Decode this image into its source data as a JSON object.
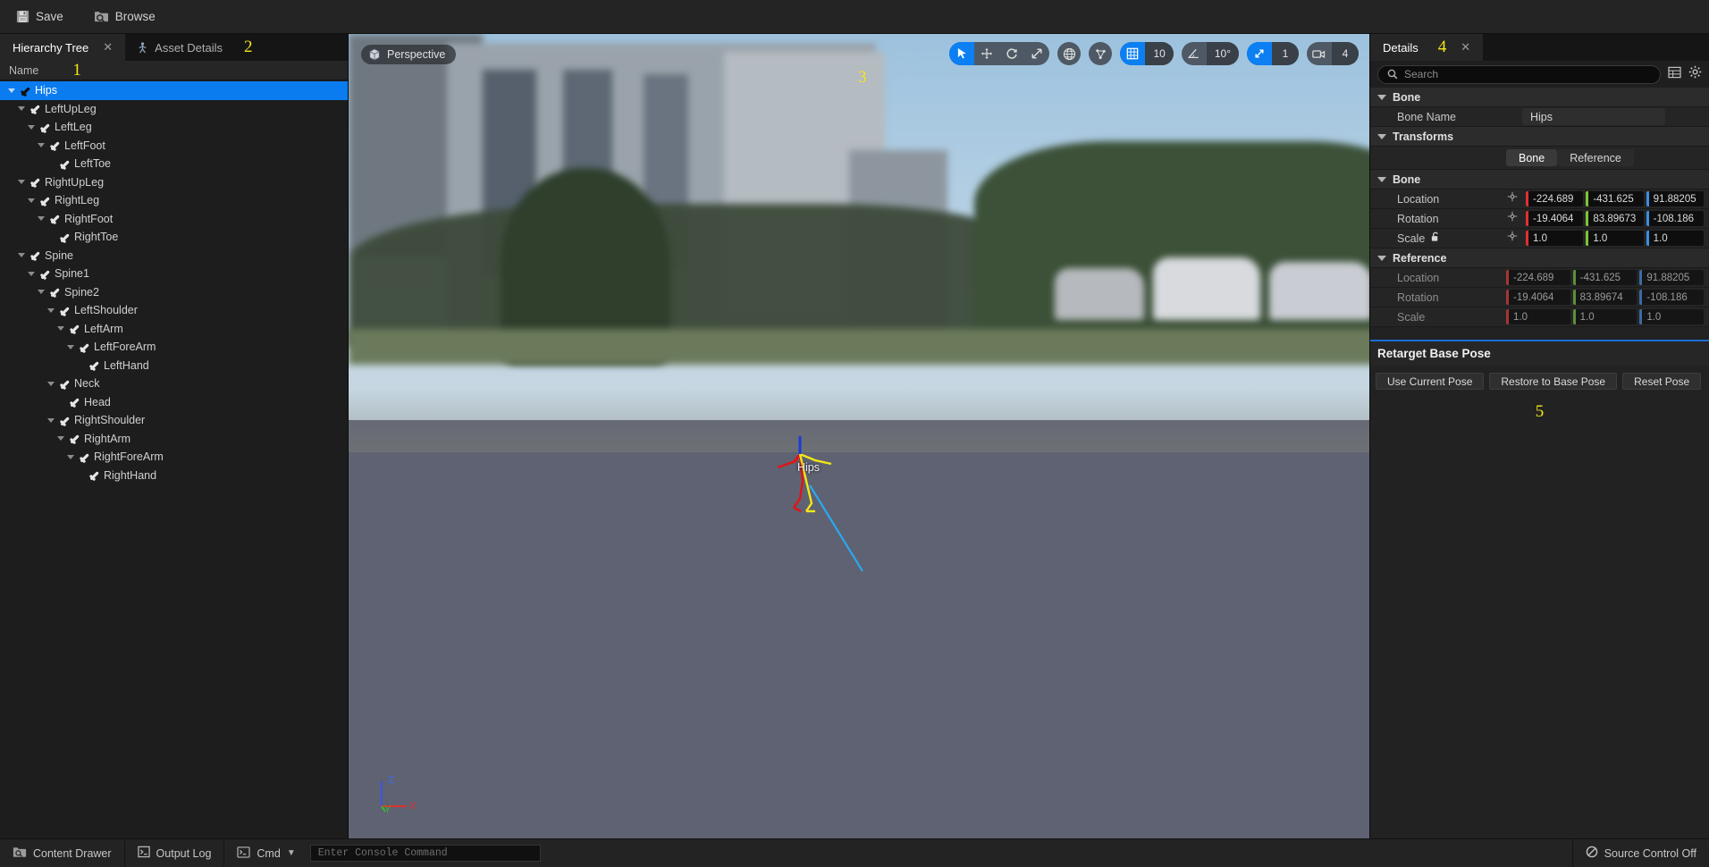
{
  "toolbar": {
    "save_label": "Save",
    "browse_label": "Browse"
  },
  "left_panel": {
    "tabs": [
      {
        "label": "Hierarchy Tree",
        "icon": "none",
        "active": true,
        "close": "✕"
      },
      {
        "label": "Asset Details",
        "icon": "skeleton-icon",
        "active": false
      }
    ],
    "annotation": "1",
    "annotation2": "2",
    "column_header": "Name",
    "tree": [
      {
        "label": "Hips",
        "depth": 0,
        "expanded": true,
        "selected": true
      },
      {
        "label": "LeftUpLeg",
        "depth": 1,
        "expanded": true,
        "selected": false
      },
      {
        "label": "LeftLeg",
        "depth": 2,
        "expanded": true,
        "selected": false
      },
      {
        "label": "LeftFoot",
        "depth": 3,
        "expanded": true,
        "selected": false
      },
      {
        "label": "LeftToe",
        "depth": 4,
        "expanded": false,
        "selected": false
      },
      {
        "label": "RightUpLeg",
        "depth": 1,
        "expanded": true,
        "selected": false
      },
      {
        "label": "RightLeg",
        "depth": 2,
        "expanded": true,
        "selected": false
      },
      {
        "label": "RightFoot",
        "depth": 3,
        "expanded": true,
        "selected": false
      },
      {
        "label": "RightToe",
        "depth": 4,
        "expanded": false,
        "selected": false
      },
      {
        "label": "Spine",
        "depth": 1,
        "expanded": true,
        "selected": false
      },
      {
        "label": "Spine1",
        "depth": 2,
        "expanded": true,
        "selected": false
      },
      {
        "label": "Spine2",
        "depth": 3,
        "expanded": true,
        "selected": false
      },
      {
        "label": "LeftShoulder",
        "depth": 4,
        "expanded": true,
        "selected": false
      },
      {
        "label": "LeftArm",
        "depth": 5,
        "expanded": true,
        "selected": false
      },
      {
        "label": "LeftForeArm",
        "depth": 6,
        "expanded": true,
        "selected": false
      },
      {
        "label": "LeftHand",
        "depth": 7,
        "expanded": false,
        "selected": false
      },
      {
        "label": "Neck",
        "depth": 4,
        "expanded": true,
        "selected": false
      },
      {
        "label": "Head",
        "depth": 5,
        "expanded": false,
        "selected": false
      },
      {
        "label": "RightShoulder",
        "depth": 4,
        "expanded": true,
        "selected": false
      },
      {
        "label": "RightArm",
        "depth": 5,
        "expanded": true,
        "selected": false
      },
      {
        "label": "RightForeArm",
        "depth": 6,
        "expanded": true,
        "selected": false
      },
      {
        "label": "RightHand",
        "depth": 7,
        "expanded": false,
        "selected": false
      }
    ]
  },
  "viewport": {
    "perspective_label": "Perspective",
    "annotation": "3",
    "selected_bone_label": "Hips",
    "axis_labels": {
      "x": "X",
      "y": "Y",
      "z": "Z"
    },
    "toolbar": {
      "select_icon": "cursor-arrow-icon",
      "move_icon": "move-gizmo-icon",
      "rotate_icon": "rotate-gizmo-icon",
      "scale_icon": "scale-gizmo-icon",
      "coord_space_icon": "world-globe-icon",
      "surface_snap_icon": "surface-snap-icon",
      "grid_snap_icon": "grid-snap-icon",
      "grid_snap_value": "10",
      "angle_snap_icon": "angle-snap-icon",
      "angle_snap_value": "10°",
      "scale_snap_icon": "scale-snap-icon",
      "scale_snap_value": "1",
      "camera_speed_icon": "camera-icon",
      "camera_speed_value": "4"
    }
  },
  "details": {
    "tab_label": "Details",
    "tab_close": "✕",
    "annotation": "4",
    "search_placeholder": "Search",
    "search_value": "",
    "grid_view_icon": "column-view-icon",
    "settings_icon": "gear-icon",
    "sections": {
      "bone_header": "Bone",
      "bone_name_label": "Bone Name",
      "bone_name_value": "Hips",
      "transforms_header": "Transforms",
      "toggle_bone": "Bone",
      "toggle_reference": "Reference",
      "bone_sub_header": "Bone",
      "reference_sub_header": "Reference",
      "location_label": "Location",
      "rotation_label": "Rotation",
      "scale_label": "Scale",
      "bone_location": [
        "-224.689",
        "-431.625",
        "91.88205"
      ],
      "bone_rotation": [
        "-19.4064",
        "83.89673",
        "-108.186"
      ],
      "bone_scale": [
        "1.0",
        "1.0",
        "1.0"
      ],
      "reference_location": [
        "-224.689",
        "-431.625",
        "91.88205"
      ],
      "reference_rotation": [
        "-19.4064",
        "83.89674",
        "-108.186"
      ],
      "reference_scale": [
        "1.0",
        "1.0",
        "1.0"
      ]
    },
    "retarget": {
      "title": "Retarget Base Pose",
      "buttons": [
        "Use Current Pose",
        "Restore to Base Pose",
        "Reset Pose"
      ],
      "annotation": "5"
    }
  },
  "status_bar": {
    "content_drawer": "Content Drawer",
    "output_log": "Output Log",
    "cmd_label": "Cmd",
    "console_placeholder": "Enter Console Command",
    "console_value": "",
    "source_control": "Source Control Off"
  },
  "colors": {
    "accent_blue": "#0a7cf0",
    "axis_x": "#e03030",
    "axis_y": "#5ac43a",
    "axis_z": "#3a7fe0",
    "annotation_yellow": "#f5e51a"
  }
}
